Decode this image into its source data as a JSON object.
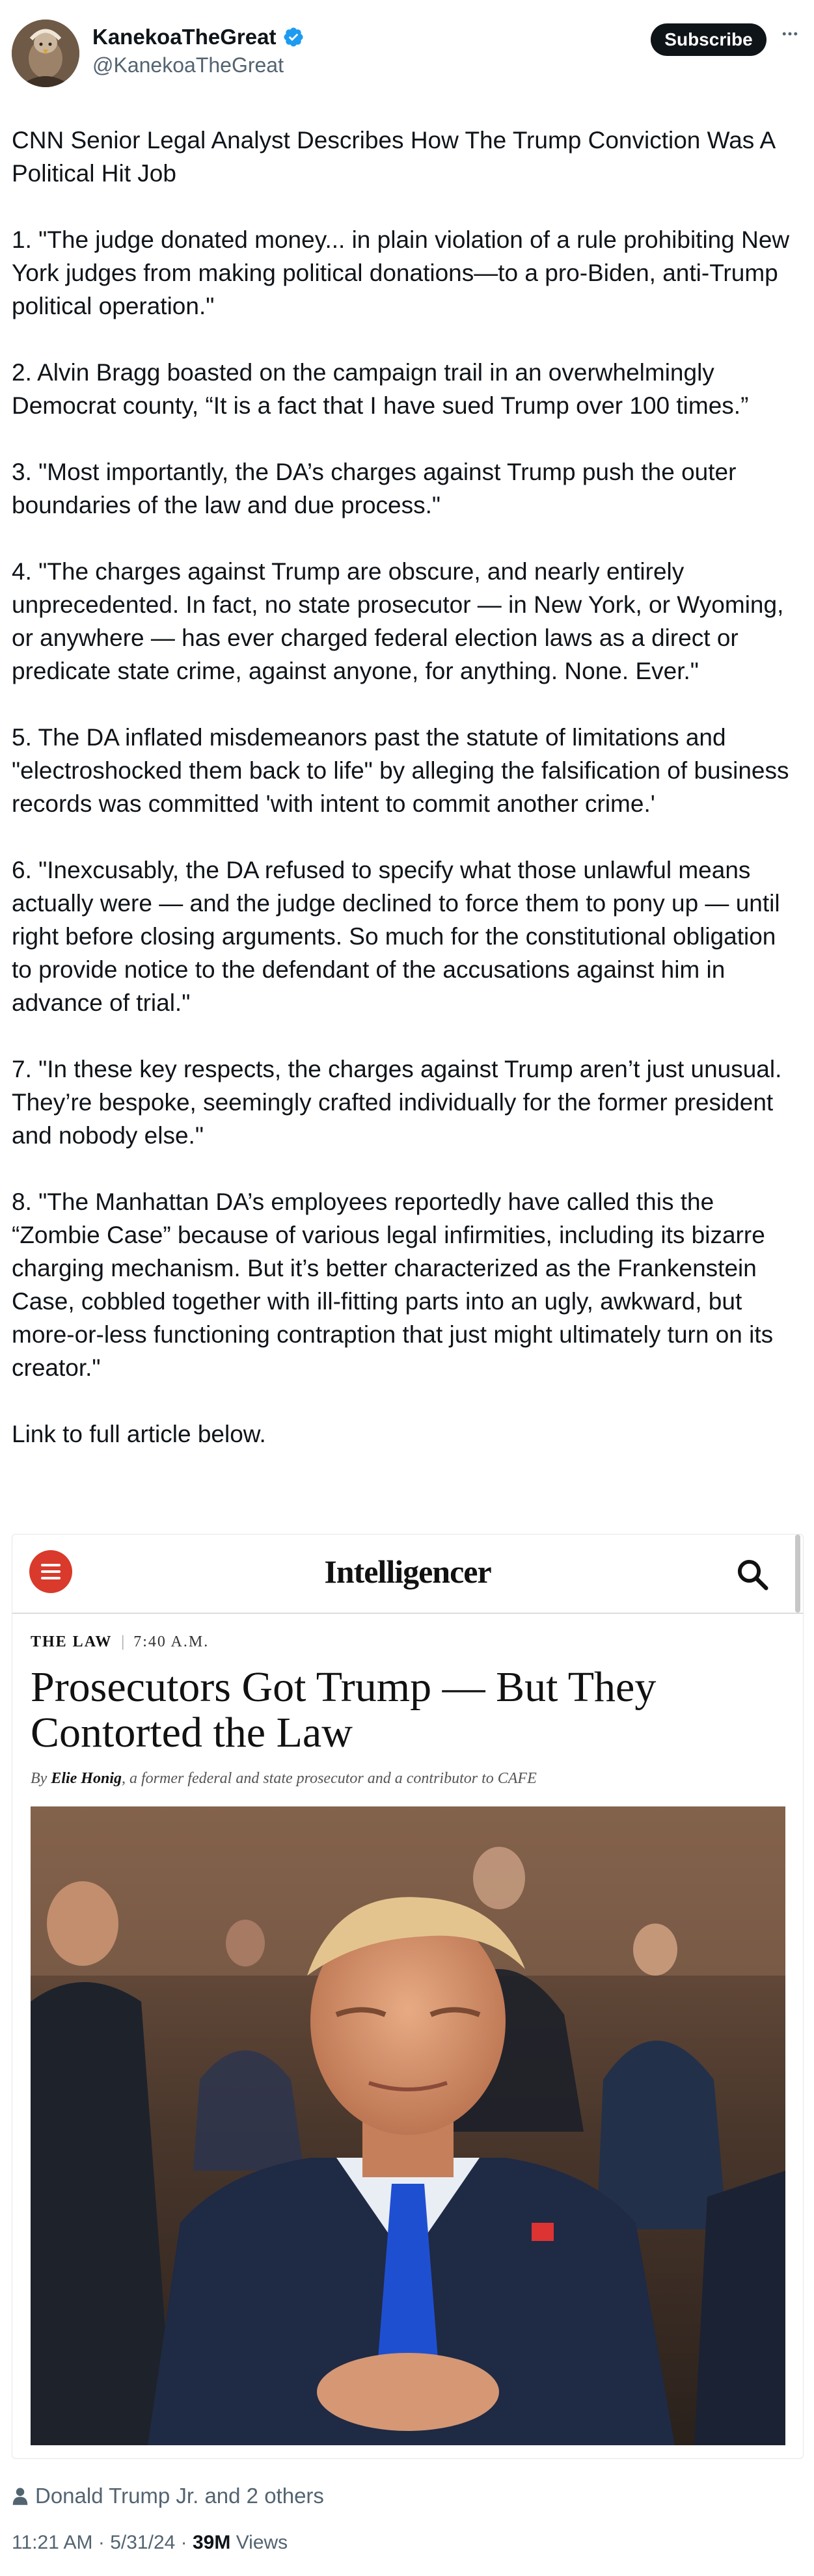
{
  "header": {
    "display_name": "KanekoaTheGreat",
    "handle": "@KanekoaTheGreat",
    "verified_icon": "verified-badge-icon",
    "subscribe_label": "Subscribe",
    "more_icon": "more-options-icon"
  },
  "tweet": {
    "paragraphs": [
      "CNN Senior Legal Analyst Describes How The Trump Conviction Was A Political Hit Job",
      "1. \"The judge donated money... in plain violation of a rule prohibiting New York judges from making political donations—to a pro-Biden, anti-Trump political operation.\"",
      "2. Alvin Bragg boasted on the campaign trail in an overwhelmingly Democrat county, “It is a fact that I have sued Trump over 100 times.”",
      "3. \"Most importantly, the DA’s charges against Trump push the outer boundaries of the law and due process.\"",
      "4. \"The charges against Trump are obscure, and nearly entirely unprecedented. In fact, no state prosecutor — in New York, or Wyoming, or anywhere — has ever charged federal election laws as a direct or predicate state crime, against anyone, for anything. None. Ever.\"",
      "5. The DA inflated misdemeanors past the statute of limitations and \"electroshocked them back to life\" by alleging the falsification of business records was committed 'with intent to commit another crime.'",
      "6. \"Inexcusably, the DA refused to specify what those unlawful means actually were — and the judge declined to force them to pony up — until right before closing arguments. So much for the constitutional obligation to provide notice to the defendant of the accusations against him in advance of trial.\"",
      "7. \"In these key respects, the charges against Trump aren’t just unusual. They’re bespoke, seemingly crafted individually for the former president and nobody else.\"",
      "8. \"The Manhattan DA’s employees reportedly have called this the “Zombie Case” because of various legal infirmities, including its bizarre charging mechanism. But it’s better characterized as the Frankenstein Case, cobbled together with ill-fitting parts into an ugly, awkward, but more-or-less functioning contraption that just might ultimately turn on its creator.\"",
      "Link to full article below."
    ]
  },
  "card": {
    "menu_icon": "hamburger-menu-icon",
    "brand": "Intelligencer",
    "search_icon": "search-icon",
    "section": "THE LAW",
    "time": "7:40 A.M.",
    "headline": "Prosecutors Got Trump — But They Contorted the Law",
    "byline_prefix": "By",
    "author": "Elie Honig",
    "byline_suffix": ", a former federal and state prosecutor and a contributor to CAFE",
    "photo_alt": "article-photo"
  },
  "footer": {
    "likes_icon": "person-icon",
    "liked_by": "Donald Trump Jr. and 2 others",
    "time": "11:21 AM",
    "date": "5/31/24",
    "separator": "·",
    "views_count": "39M",
    "views_label": "Views"
  },
  "colors": {
    "text": "#0f1419",
    "muted": "#536471",
    "verified": "#1d9bf0",
    "menu_red": "#d93a2b"
  }
}
